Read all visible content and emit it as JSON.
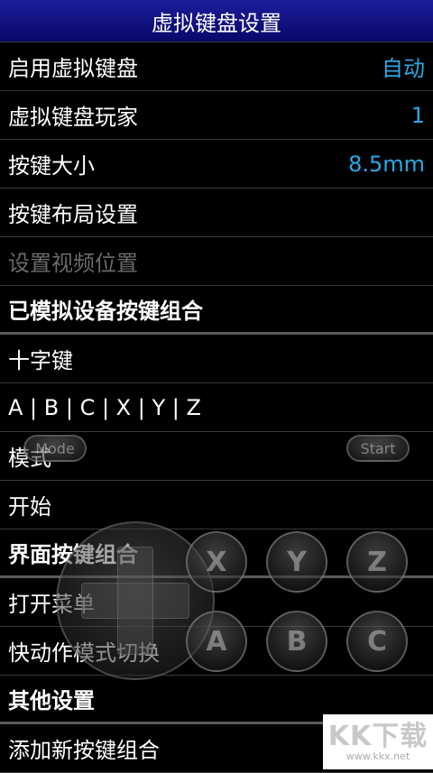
{
  "title": "虚拟键盘设置",
  "rows": [
    {
      "label": "启用虚拟键盘",
      "value": "自动"
    },
    {
      "label": "虚拟键盘玩家",
      "value": "1"
    },
    {
      "label": "按键大小",
      "value": "8.5mm"
    },
    {
      "label": "按键布局设置"
    },
    {
      "label": "设置视频位置"
    },
    {
      "label": "已模拟设备按键组合"
    },
    {
      "label": "十字键"
    },
    {
      "label": "A | B | C | X | Y | Z"
    },
    {
      "label": "模式"
    },
    {
      "label": "开始"
    },
    {
      "label": "界面按键组合"
    },
    {
      "label": "打开菜单"
    },
    {
      "label": "快动作模式切换"
    },
    {
      "label": "其他设置"
    },
    {
      "label": "添加新按键组合"
    }
  ],
  "overlay": {
    "mode_label": "Mode",
    "start_label": "Start",
    "buttons": [
      "X",
      "Y",
      "Z",
      "A",
      "B",
      "C"
    ]
  },
  "watermark": {
    "main": "KK下载",
    "sub": "www.kkx.net"
  },
  "colors": {
    "titlebar": "#10108a",
    "value_text": "#2aa8e6",
    "background": "#000000"
  }
}
